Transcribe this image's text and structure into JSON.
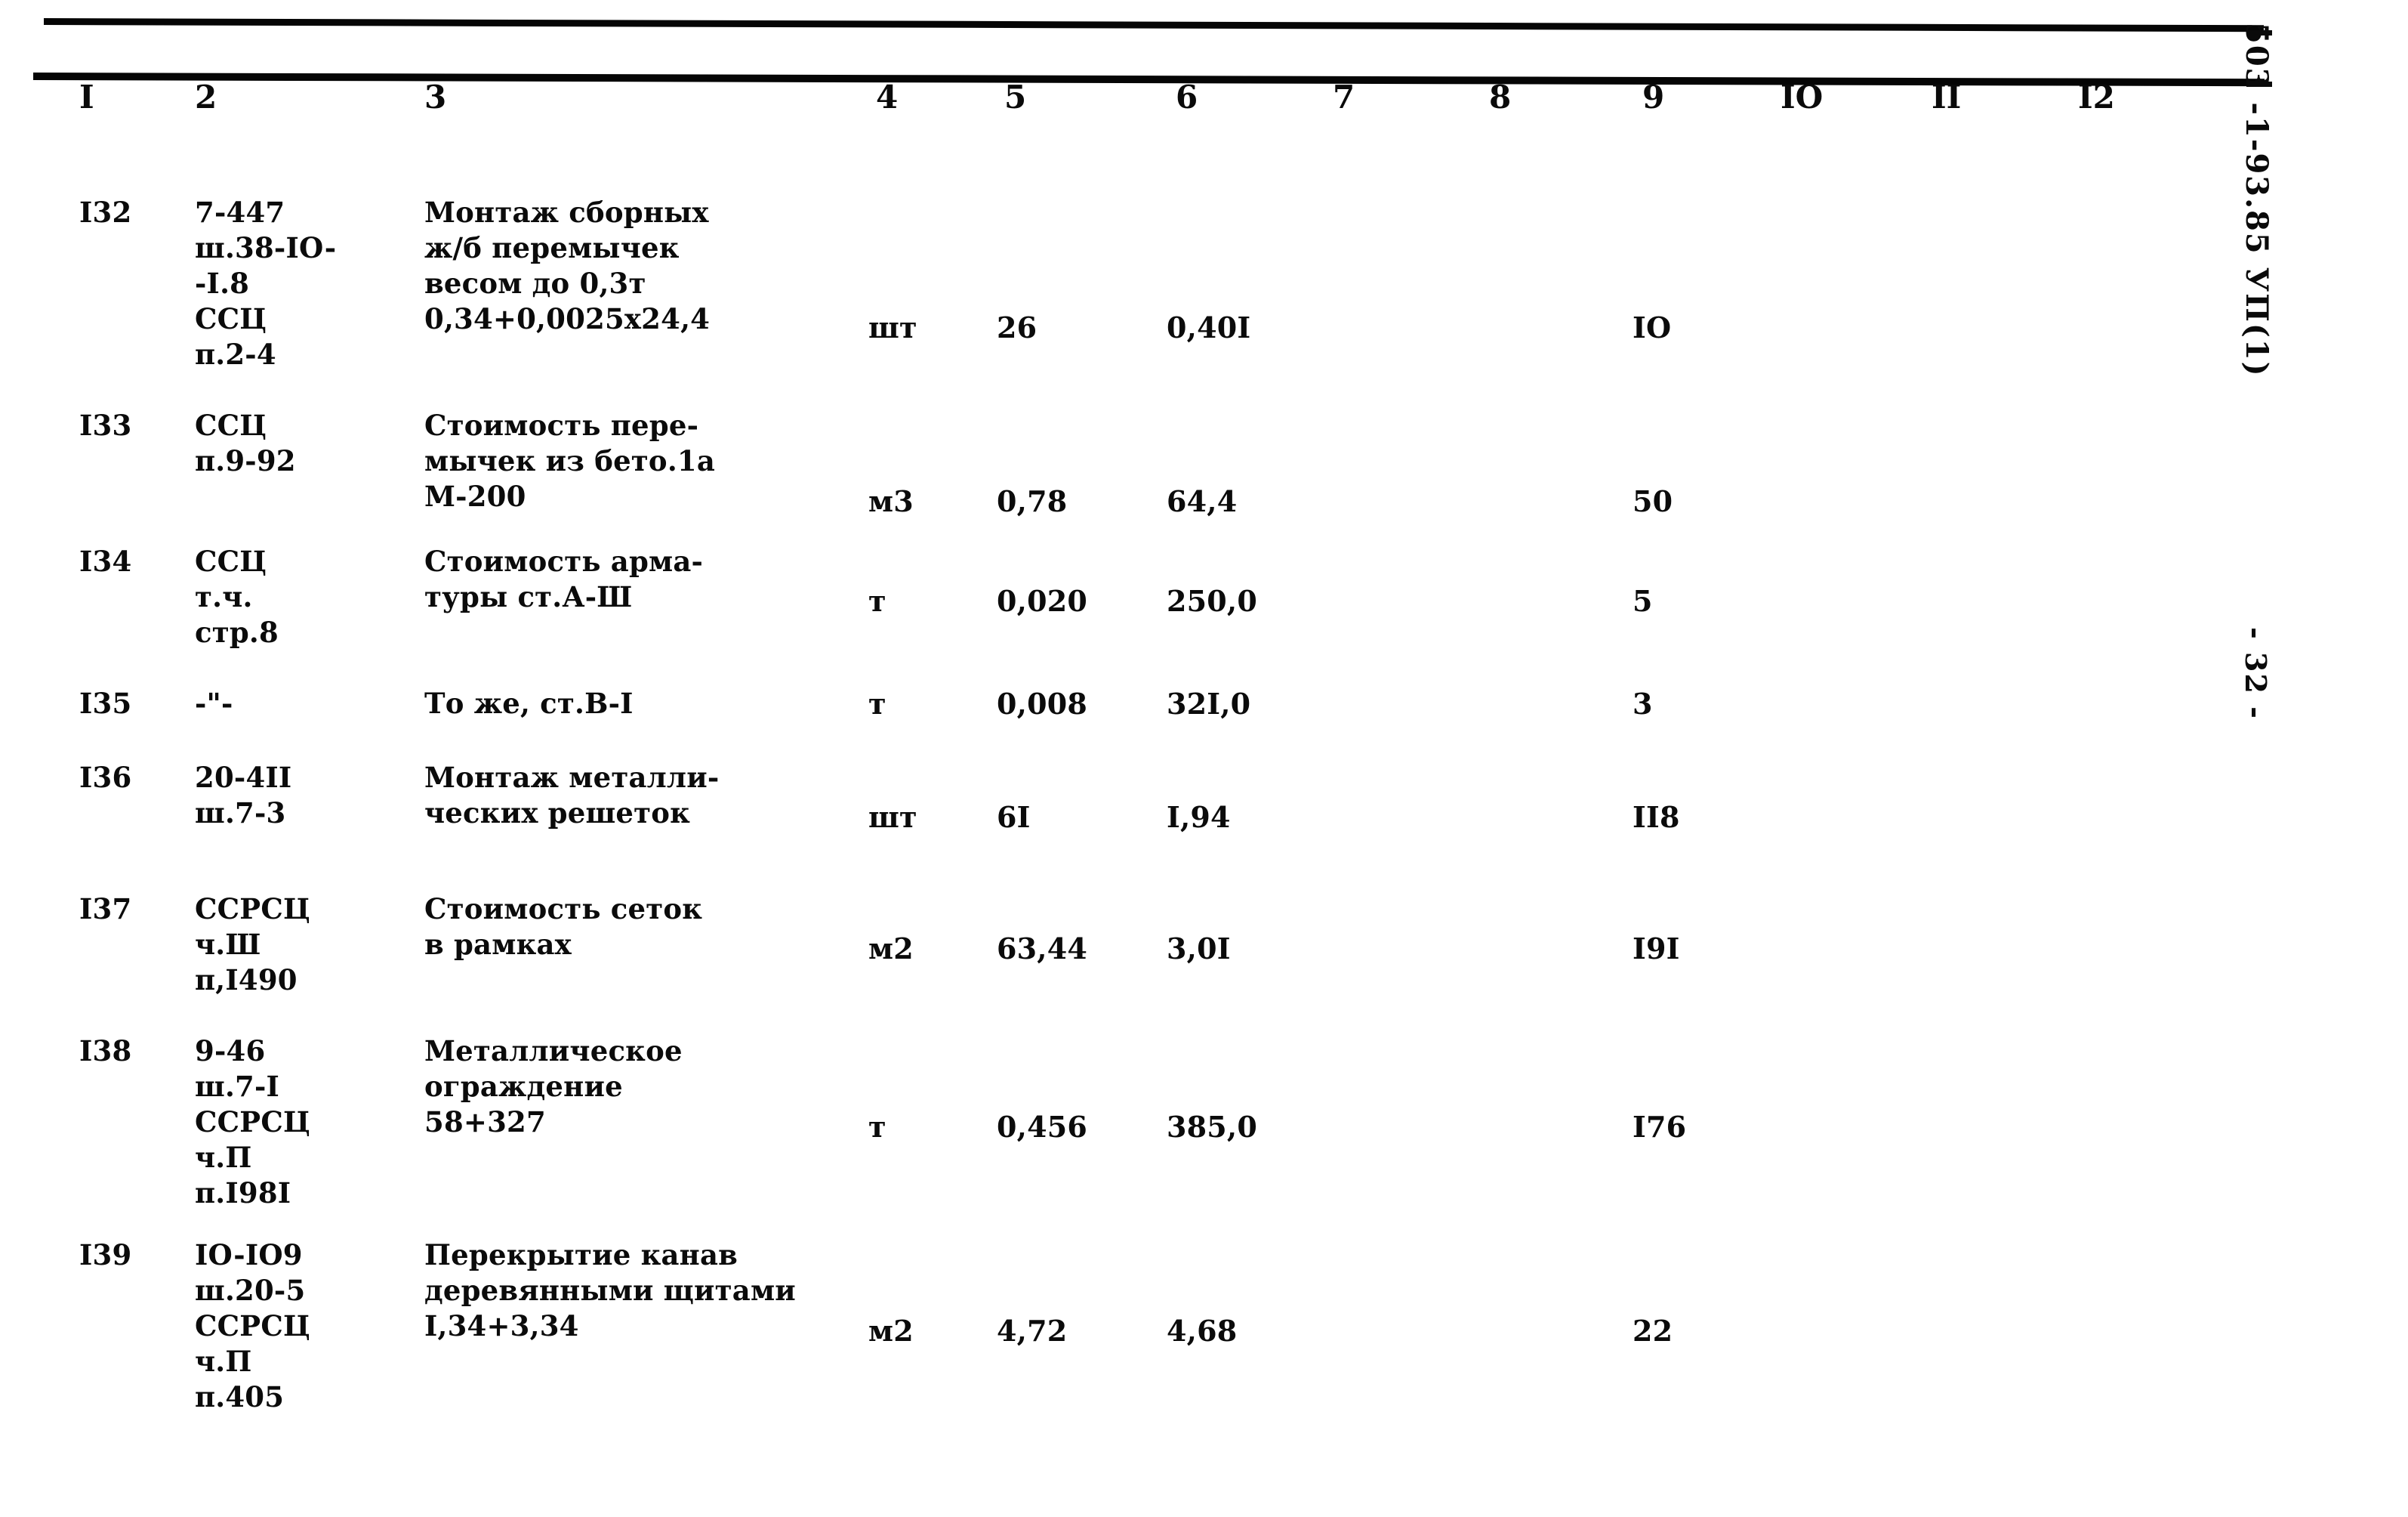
{
  "document": {
    "margin_code": "503 -1-93.85  УП(1)",
    "page_marker": "- 32 -"
  },
  "table": {
    "column_headers": [
      "I",
      "2",
      "3",
      "4",
      "5",
      "6",
      "7",
      "8",
      "9",
      "IO",
      "II",
      "I2"
    ],
    "rows": [
      {
        "c1": "I32",
        "c2": "7-447\nш.38-IO-\n-I.8\nССЦ\nп.2-4",
        "c3": "Монтаж сборных\nж/б перемычек\nвесом до 0,3т\n0,34+0,0025х24,4",
        "c4": "шт",
        "c5": "26",
        "c6": "0,40I",
        "c7": "",
        "c8": "",
        "c9": "IO",
        "c10": "",
        "c11": "",
        "c12": ""
      },
      {
        "c1": "I33",
        "c2": "ССЦ\nп.9-92",
        "c3": "Стоимость пере-\nмычек из бето.1а\nМ-200",
        "c4": "м3",
        "c5": "0,78",
        "c6": "64,4",
        "c7": "",
        "c8": "",
        "c9": "50",
        "c10": "",
        "c11": "",
        "c12": ""
      },
      {
        "c1": "I34",
        "c2": "ССЦ\nт.ч.\nстр.8",
        "c3": "Стоимость арма-\nтуры ст.А-Ш",
        "c4": "т",
        "c5": "0,020",
        "c6": "250,0",
        "c7": "",
        "c8": "",
        "c9": "5",
        "c10": "",
        "c11": "",
        "c12": ""
      },
      {
        "c1": "I35",
        "c2": "-\"-",
        "c3": "То же, ст.В-I",
        "c4": "т",
        "c5": "0,008",
        "c6": "32I,0",
        "c7": "",
        "c8": "",
        "c9": "3",
        "c10": "",
        "c11": "",
        "c12": ""
      },
      {
        "c1": "I36",
        "c2": "20-4II\nш.7-3",
        "c3": "Монтаж металли-\nческих решеток",
        "c4": "шт",
        "c5": "6I",
        "c6": "I,94",
        "c7": "",
        "c8": "",
        "c9": "II8",
        "c10": "",
        "c11": "",
        "c12": ""
      },
      {
        "c1": "I37",
        "c2": "ССРСЦ\nч.Ш\nп,I490",
        "c3": "Стоимость сеток\nв рамках",
        "c4": "м2",
        "c5": "63,44",
        "c6": "3,0I",
        "c7": "",
        "c8": "",
        "c9": "I9I",
        "c10": "",
        "c11": "",
        "c12": ""
      },
      {
        "c1": "I38",
        "c2": "9-46\nш.7-I\nССРСЦ\nч.П\nп.I98I",
        "c3": "Металлическое\nограждение\n58+327",
        "c4": "т",
        "c5": "0,456",
        "c6": "385,0",
        "c7": "",
        "c8": "",
        "c9": "I76",
        "c10": "",
        "c11": "",
        "c12": ""
      },
      {
        "c1": "I39",
        "c2": "IO-IO9\nш.20-5\nССРСЦ\nч.П\nп.405",
        "c3": "Перекрытие канав\nдеревянными щитами\nI,34+3,34",
        "c4": "м2",
        "c5": "4,72",
        "c6": "4,68",
        "c7": "",
        "c8": "",
        "c9": "22",
        "c10": "",
        "c11": "",
        "c12": ""
      }
    ]
  }
}
